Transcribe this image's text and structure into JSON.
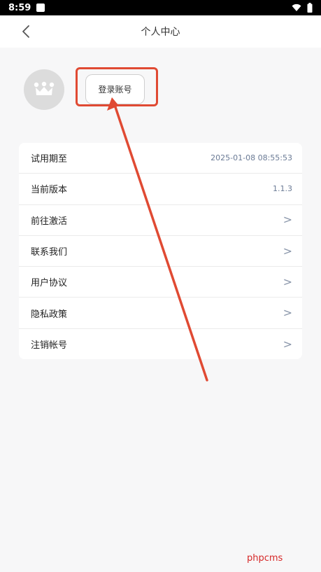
{
  "status_bar": {
    "time": "8:59"
  },
  "header": {
    "title": "个人中心"
  },
  "profile": {
    "login_label": "登录账号"
  },
  "menu": {
    "items": [
      {
        "label": "试用期至",
        "value": "2025-01-08 08:55:53"
      },
      {
        "label": "当前版本",
        "value": "1.1.3"
      },
      {
        "label": "前往激活",
        "chevron": ">"
      },
      {
        "label": "联系我们",
        "chevron": ">"
      },
      {
        "label": "用户协议",
        "chevron": ">"
      },
      {
        "label": "隐私政策",
        "chevron": ">"
      },
      {
        "label": "注销帐号",
        "chevron": ">"
      }
    ]
  },
  "watermark": {
    "text": "phpcms"
  },
  "colors": {
    "highlight": "#e04a33",
    "value_text": "#6a7a95",
    "background": "#f7f7f8",
    "avatar_bg": "#dcdcdc"
  },
  "icons": [
    "back-icon",
    "crown-icon",
    "wifi-icon",
    "battery-icon",
    "notification-icon"
  ]
}
